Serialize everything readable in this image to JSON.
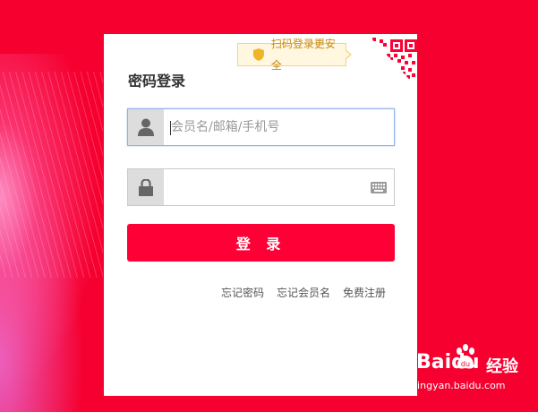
{
  "tip": {
    "text": "扫码登录更安全",
    "icon": "shield-icon"
  },
  "qr": {
    "icon": "qr-code-icon"
  },
  "login": {
    "title": "密码登录",
    "username": {
      "placeholder": "会员名/邮箱/手机号",
      "value": "",
      "icon": "user-icon"
    },
    "password": {
      "placeholder": "",
      "value": "",
      "icon": "lock-icon",
      "keyboard_icon": "keyboard-icon"
    },
    "submit_label": "登 录"
  },
  "links": {
    "forgot_password": "忘记密码",
    "forgot_username": "忘记会员名",
    "register": "免费注册"
  },
  "watermark": {
    "brand": "Baidu",
    "product": "经验",
    "url": "jingyan.baidu.com"
  },
  "colors": {
    "background": "#f5002f",
    "button": "#ff0036",
    "tip_text": "#c98a10",
    "focus_border": "#8fb2e8"
  }
}
